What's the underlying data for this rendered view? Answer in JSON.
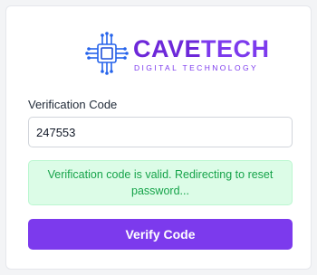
{
  "logo": {
    "icon": "circuit-chip-icon",
    "brand_part1": "CAVE",
    "brand_part2": "TECH",
    "tagline": "DIGITAL TECHNOLOGY"
  },
  "form": {
    "code_label": "Verification Code",
    "code_value": "247553",
    "alert_message": "Verification code is valid. Redirecting to reset password...",
    "submit_label": "Verify Code"
  },
  "colors": {
    "accent": "#7c3aed",
    "success_bg": "#dcfce7",
    "success_text": "#16a34a"
  }
}
